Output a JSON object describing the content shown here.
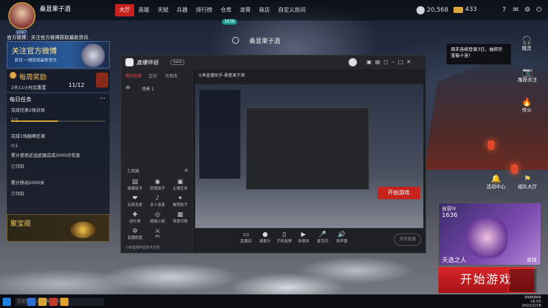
{
  "profile": {
    "username": "桑葚果子酒",
    "level": "1097"
  },
  "nav": {
    "tabs": [
      "大厅",
      "英雄",
      "天赋",
      "兵器",
      "排行榜",
      "仓库",
      "凌霄",
      "商店",
      "自定义房间"
    ],
    "active_index": 0
  },
  "currency": {
    "silver": "20,568",
    "gold": "433"
  },
  "online_badge": "1636",
  "window_title": "桑葚果子酒",
  "announcement": {
    "label": "官方微博：关注官方微博获取最新资讯",
    "banner_title": "关注官方微博",
    "banner_sub": "首页·一键获取最新资讯"
  },
  "reward": {
    "title": "每周奖励",
    "sub": "2天11小时后重置",
    "count": "11/12"
  },
  "tasks": {
    "title": "每日任务",
    "more": "...",
    "items": [
      {
        "text": "完成任意2场对局",
        "progress": "1/2",
        "fraction": 0.5
      },
      {
        "text": "完成1场巅峰狂潮",
        "progress": "0/1",
        "fraction": 0
      },
      {
        "text": "累计使用近战武器造成2000点伤害",
        "progress": "已领取",
        "fraction": 1
      },
      {
        "text": "累计移动2000米",
        "progress": "已领取",
        "fraction": 1
      }
    ],
    "highlight": "2000"
  },
  "treasure": "聚宝阁",
  "streamer": {
    "app_name": "直播伴侣",
    "version": "beta",
    "tabs": [
      "我的场景",
      "互动",
      "可更改"
    ],
    "scene_name": "场景 1",
    "toolbox_label": "工具箱",
    "tools": [
      "弹幕助手",
      "房管助手",
      "主播任务",
      "玩家连麦",
      "多人连麦",
      "推荐助手",
      "送礼物",
      "超级火箭",
      "场景切换",
      "直播配置",
      "PK"
    ],
    "header_line": "斗鱼直播助手-桑葚果子酒",
    "bottom_tools": [
      "直播间",
      "摄像头",
      "手机投屏",
      "多媒体",
      "麦克风",
      "扬声器"
    ],
    "end_button": "关闭直播",
    "footer": "小象直播伴侣技术支持"
  },
  "right": {
    "icons": [
      "精灵",
      "推荐关注",
      "传火",
      "活动中心",
      "组队大厅"
    ],
    "notice": "周末连续登录3日，抽奖珍宝箱十连！"
  },
  "mode": {
    "name": "自营IV",
    "id": "1636",
    "title": "天选之人",
    "tag": "单排"
  },
  "play_button": "开始游戏",
  "user_badge": "9986866",
  "clock": {
    "time": "16:55",
    "date": "2022/2/18"
  },
  "taskbar_search": "在这里输入你要搜索的内容"
}
